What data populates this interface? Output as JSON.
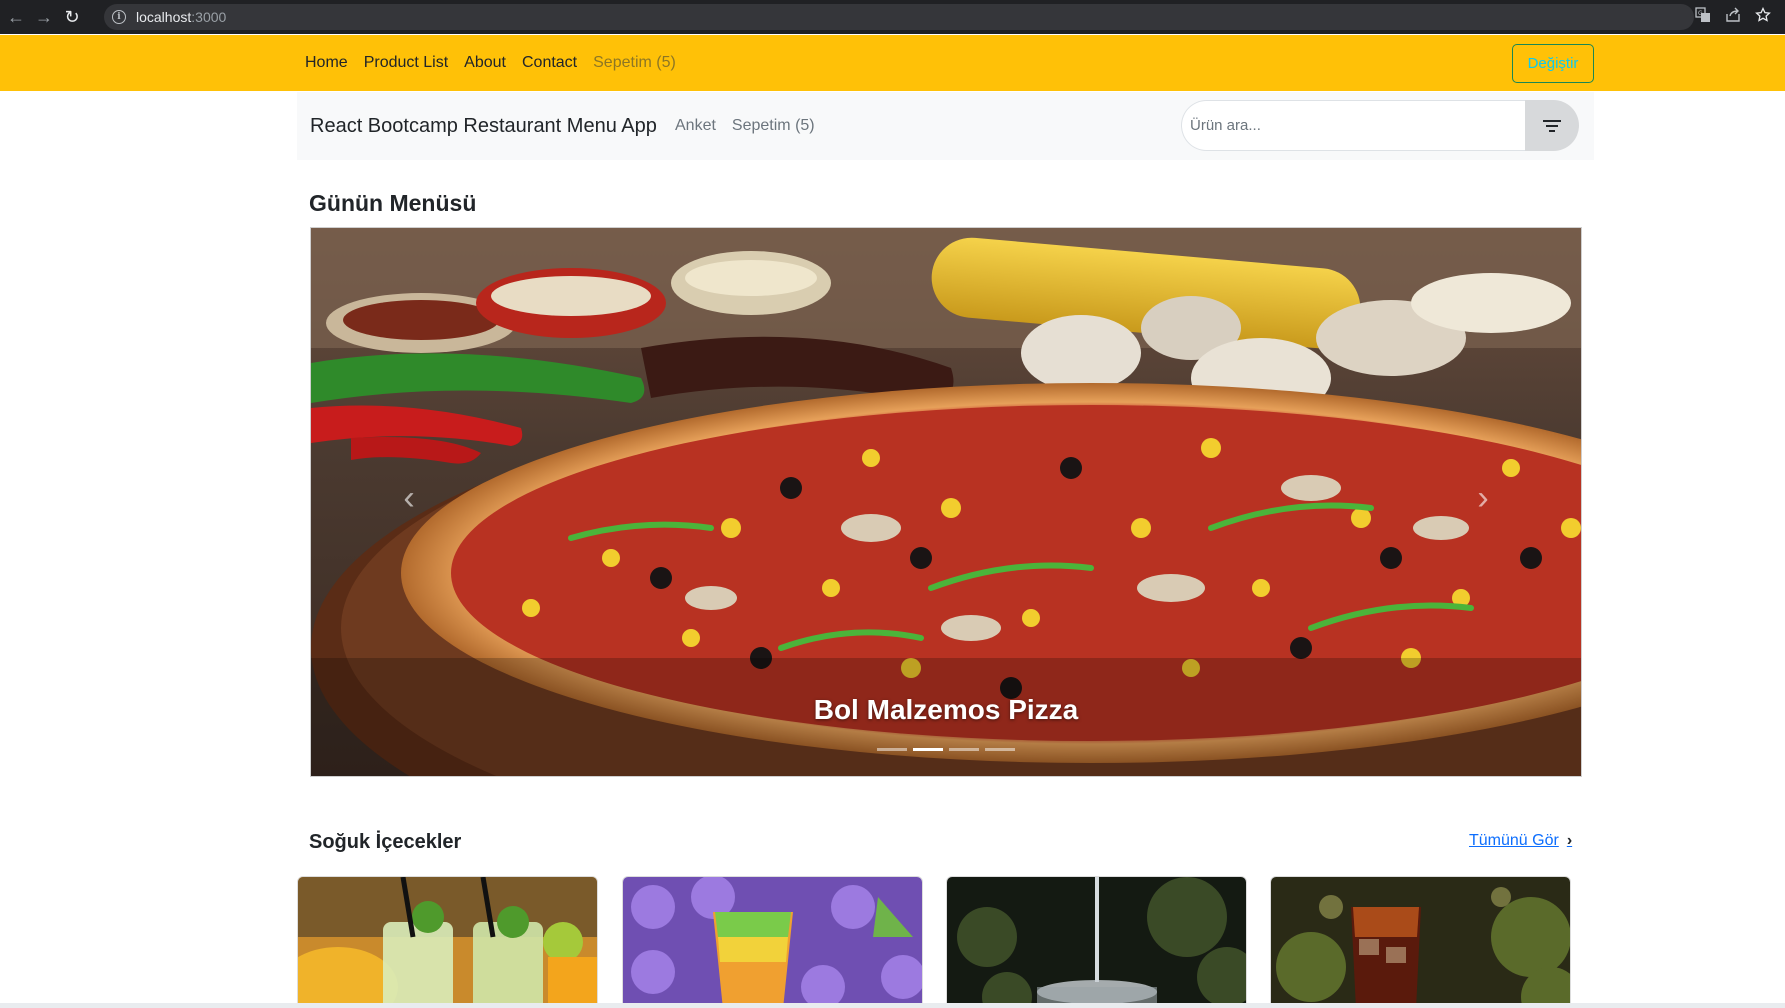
{
  "browser": {
    "url_host": "localhost",
    "url_port": ":3000",
    "icons": [
      "back-arrow-icon",
      "forward-arrow-icon",
      "reload-icon",
      "info-icon",
      "translate-icon",
      "share-icon",
      "bookmark-star-icon"
    ]
  },
  "top_nav": {
    "links": [
      "Home",
      "Product List",
      "About",
      "Contact",
      "Sepetim (5)"
    ],
    "toggle_button": "Değiştir",
    "background": "#ffc107"
  },
  "sub_nav": {
    "brand": "React Bootcamp Restaurant Menu App",
    "links": [
      "Anket",
      "Sepetim (5)"
    ],
    "search_placeholder": "Ürün ara...",
    "filter_icon": "filter-icon"
  },
  "menu_of_day": {
    "title": "Günün Menüsü",
    "carousel": {
      "caption": "Bol Malzemos Pizza",
      "slide_count": 4,
      "active_index": 1
    }
  },
  "cold_drinks": {
    "title": "Soğuk İçecekler",
    "see_all": "Tümünü Gör",
    "cards": [
      "mojito-drink-image",
      "rainbow-drink-image",
      "water-pour-image",
      "cola-ice-image"
    ]
  }
}
